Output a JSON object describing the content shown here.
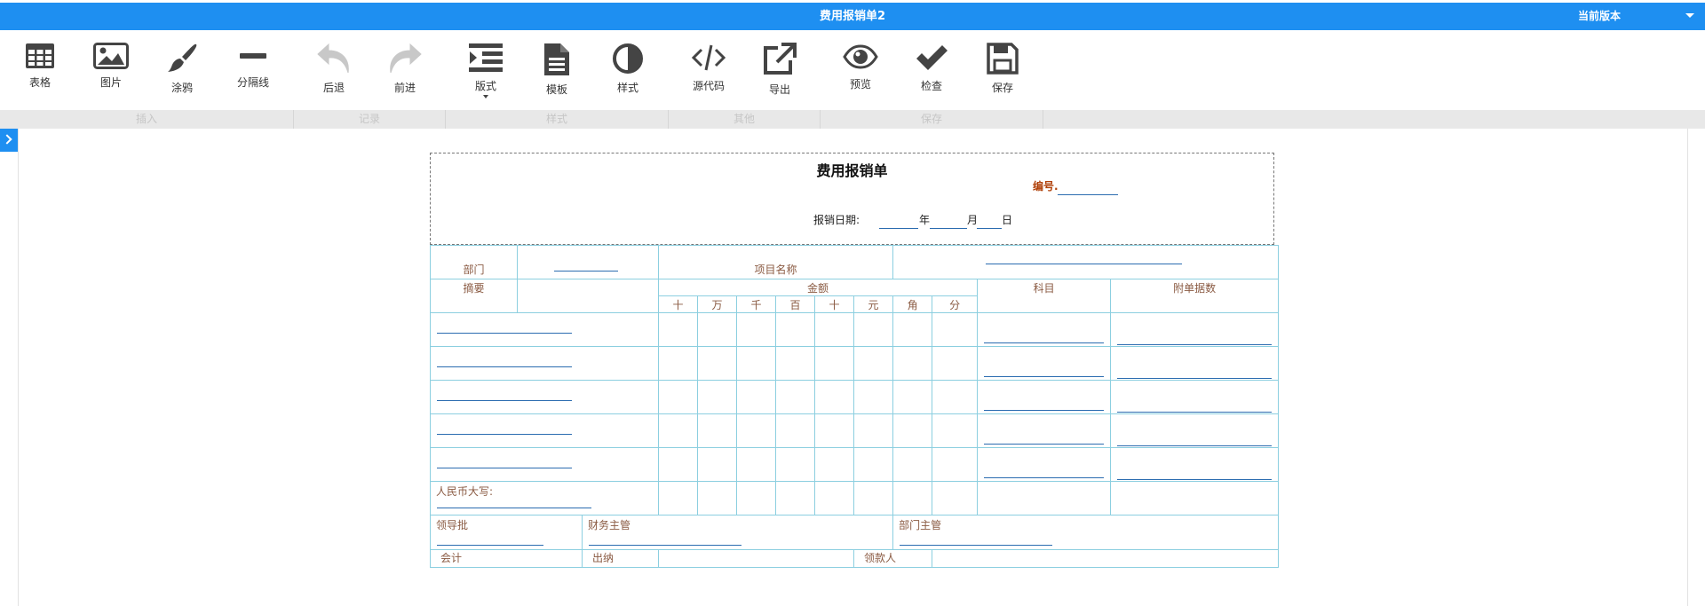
{
  "window": {
    "title": "费用报销单2",
    "version_label": "当前版本"
  },
  "toolbar": {
    "table": "表格",
    "image": "图片",
    "paint": "涂鸦",
    "divider": "分隔线",
    "undo": "后退",
    "redo": "前进",
    "layout": "版式",
    "template": "模板",
    "style": "样式",
    "source": "源代码",
    "export": "导出",
    "preview": "预览",
    "check": "检查",
    "save": "保存"
  },
  "groups": {
    "insert": "插入",
    "history": "记录",
    "style": "样式",
    "other": "其他",
    "save": "保存"
  },
  "form": {
    "title": "费用报销单",
    "number_label": "编号.",
    "date_label": "报销日期:",
    "year": "年",
    "month": "月",
    "day": "日",
    "department": "部门",
    "project_name": "项目名称",
    "summary": "摘要",
    "amount": "金额",
    "amount_units": [
      "十",
      "万",
      "千",
      "百",
      "十",
      "元",
      "角",
      "分"
    ],
    "subject": "科目",
    "attachments": "附单据数",
    "rmb_upper": "人民币大写:",
    "leader_approval": "领导批",
    "finance_supervisor": "财务主管",
    "dept_supervisor": "部门主管",
    "accountant": "会计",
    "cashier": "出纳",
    "payee": "领款人"
  }
}
